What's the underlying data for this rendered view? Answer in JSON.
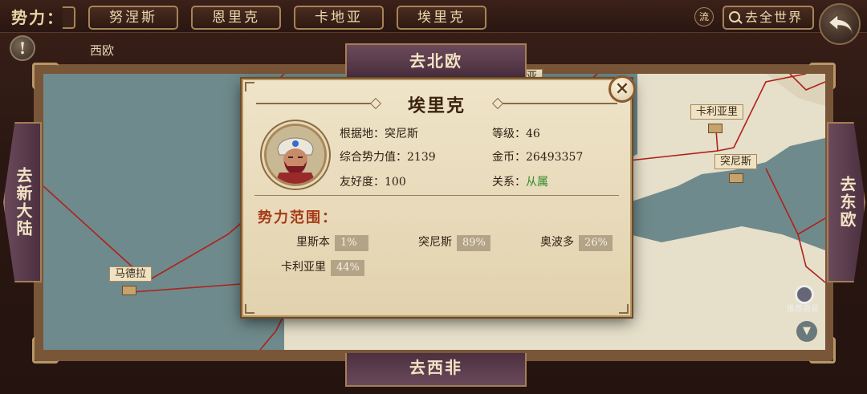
{
  "topbar": {
    "faction_label": "势力：",
    "tabs": [
      "努涅斯",
      "恩里克",
      "卡地亚",
      "埃里克"
    ],
    "flow_label": "流",
    "world_label": "去全世界"
  },
  "region_label": "西欧",
  "nav": {
    "north": "去北欧",
    "south": "去西非",
    "west": "去新大陆",
    "east": "去东欧"
  },
  "map_cities": [
    {
      "name": "马德拉"
    },
    {
      "name": "卡利亚里"
    },
    {
      "name": "突尼斯"
    },
    {
      "name": "瓦伦西亚"
    }
  ],
  "trade_label": "推荐商易",
  "dialog": {
    "title": "埃里克",
    "close_icon": "×",
    "base_label": "根据地：",
    "base_value": "突尼斯",
    "level_label": "等级：",
    "level_value": "46",
    "power_label": "综合势力值：",
    "power_value": "2139",
    "gold_label": "金币：",
    "gold_value": "26493357",
    "friend_label": "友好度：",
    "friend_value": "100",
    "relation_label": "关系：",
    "relation_value": "从属",
    "scope_title": "势力范围：",
    "scope": [
      {
        "city": "里斯本",
        "pct": "1%"
      },
      {
        "city": "突尼斯",
        "pct": "89%"
      },
      {
        "city": "奥波多",
        "pct": "26%"
      },
      {
        "city": "卡利亚里",
        "pct": "44%"
      }
    ]
  },
  "colors": {
    "relation": "#2f8a2a",
    "scope_title": "#a63a16",
    "sea": "#6f8a8c",
    "land": "#e6dfca"
  }
}
